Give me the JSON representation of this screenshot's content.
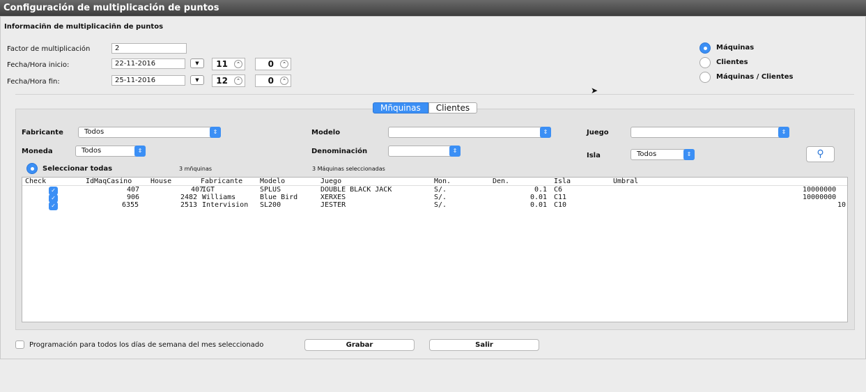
{
  "window": {
    "title": "Configuración de multiplicación de puntos"
  },
  "section": {
    "title": "Informaciñn de multiplicaciñn de puntos"
  },
  "form": {
    "factor_label": "Factor de multiplicación",
    "factor_value": "2",
    "inicio_label": "Fecha/Hora inicio:",
    "inicio_date": "22-11-2016",
    "inicio_hour": "11",
    "inicio_min": "0",
    "fin_label": "Fecha/Hora fin:",
    "fin_date": "25-11-2016",
    "fin_hour": "12",
    "fin_min": "0"
  },
  "mode": {
    "options": [
      "Máquinas",
      "Clientes",
      "Máquinas / Clientes"
    ],
    "selected": "Máquinas"
  },
  "tabs": [
    "Mñquinas",
    "Clientes"
  ],
  "filters": {
    "fabricante_label": "Fabricante",
    "fabricante_value": "Todos",
    "modelo_label": "Modelo",
    "modelo_value": "",
    "juego_label": "Juego",
    "juego_value": "",
    "moneda_label": "Moneda",
    "moneda_value": "Todos",
    "denominacion_label": "Denominación",
    "denominacion_value": "",
    "isla_label": "Isla",
    "isla_value": "Todos",
    "select_all_label": "Seleccionar todas",
    "count_text": "3 mñquinas",
    "selected_text": "3 Máquinas seleccionadas"
  },
  "table": {
    "headers": [
      "Check",
      "IdMaqCasino",
      "House",
      "Fabricante",
      "Modelo",
      "Juego",
      "Mon.",
      "Den.",
      "Isla",
      "Umbral"
    ],
    "rows": [
      [
        "407",
        "407",
        "IGT",
        "SPLUS",
        "DOUBLE BLACK JACK",
        "S/.",
        "0.1",
        "C6",
        "10000000"
      ],
      [
        "906",
        "2482",
        "Williams",
        "Blue Bird",
        "XERXES",
        "S/.",
        "0.01",
        "C11",
        "10000000"
      ],
      [
        "6355",
        "2513",
        "Intervision",
        "SL200",
        "JESTER",
        "S/.",
        "0.01",
        "C10",
        "10"
      ]
    ]
  },
  "footer": {
    "program_label": "Programación para todos los días de semana del mes seleccionado",
    "save_label": "Grabar",
    "exit_label": "Salir"
  },
  "icons": {
    "accent": "#3b8ff5"
  }
}
